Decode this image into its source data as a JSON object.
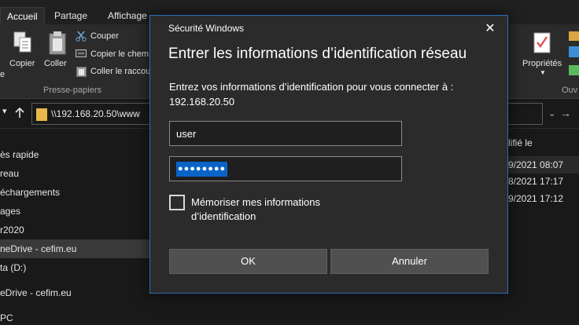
{
  "ribbon": {
    "tabs": [
      "Accueil",
      "Partage",
      "Affichage"
    ],
    "buttons": {
      "copier": "Copier",
      "coller": "Coller",
      "couper": "Couper",
      "copier_chemin": "Copier le chem",
      "coller_raccourci": "Coller le raccou",
      "proprietes": "Propriétés",
      "edge_left": "e",
      "edge_right": "Ouv"
    },
    "group_label": "Presse-papiers"
  },
  "address_bar": {
    "path": "\\\\192.168.20.50\\www"
  },
  "nav_pane": {
    "items": [
      "ès rapide",
      "reau",
      "échargements",
      "ages",
      "r2020",
      "neDrive - cefim.eu",
      "ta (D:)",
      "eDrive - cefim.eu",
      "PC"
    ],
    "selected_index": 5
  },
  "file_list": {
    "column_header": "lifié le",
    "dates": [
      "9/2021 08:07",
      "8/2021 17:17",
      "9/2021 17:12"
    ]
  },
  "dialog": {
    "caption": "Sécurité Windows",
    "close_glyph": "✕",
    "title": "Entrer les informations d’identification réseau",
    "message": "Entrez vos informations d’identification pour vous connecter à : 192.168.20.50",
    "username": "user",
    "password_mask": "●●●●●●●●",
    "remember_label": "Mémoriser mes informations d’identification",
    "remember_checked": false,
    "ok_label": "OK",
    "cancel_label": "Annuler"
  },
  "colors": {
    "accent": "#2d6db5",
    "selection": "#0a64c8",
    "background": "#191919",
    "dialog_bg": "#2b2b2b"
  }
}
